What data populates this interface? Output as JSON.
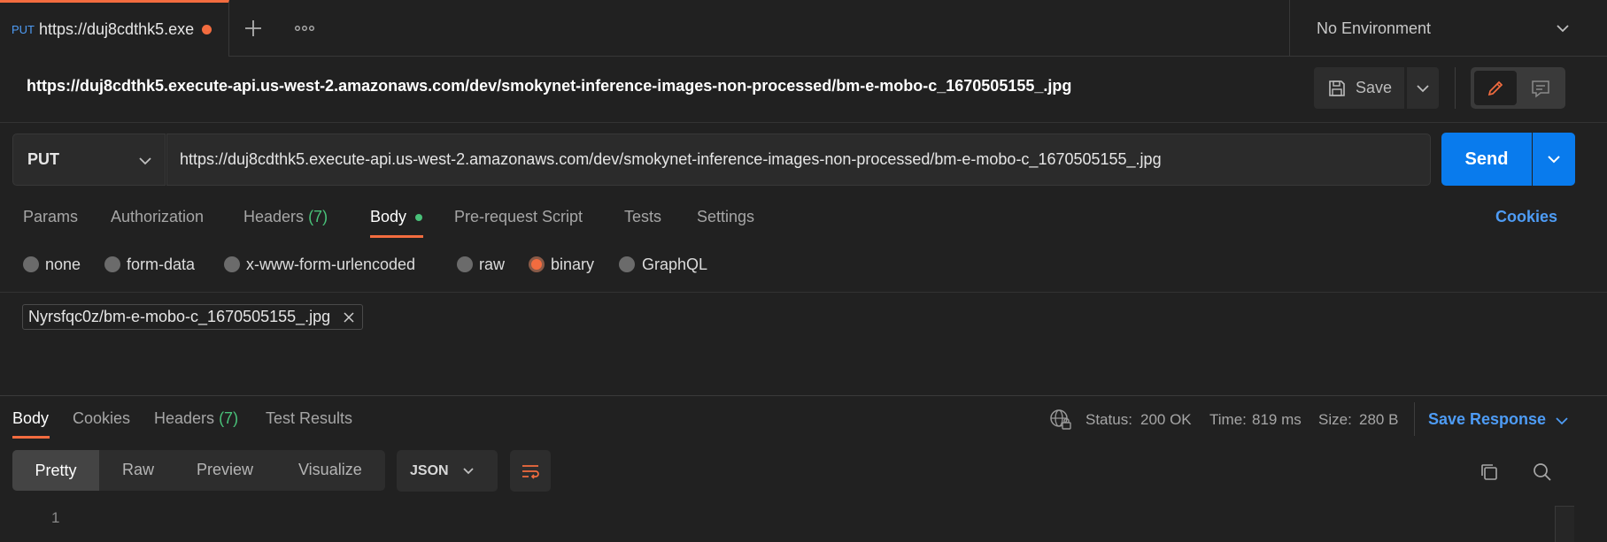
{
  "tab": {
    "method": "PUT",
    "name": "https://duj8cdthk5.exe"
  },
  "environment": {
    "selected": "No Environment"
  },
  "request": {
    "title": "https://duj8cdthk5.execute-api.us-west-2.amazonaws.com/dev/smokynet-inference-images-non-processed/bm-e-mobo-c_1670505155_.jpg",
    "save_label": "Save",
    "method": "PUT",
    "url": "https://duj8cdthk5.execute-api.us-west-2.amazonaws.com/dev/smokynet-inference-images-non-processed/bm-e-mobo-c_1670505155_.jpg",
    "send_label": "Send",
    "tabs": {
      "params": "Params",
      "authorization": "Authorization",
      "headers": "Headers",
      "headers_count": "(7)",
      "body": "Body",
      "prerequest": "Pre-request Script",
      "tests": "Tests",
      "settings": "Settings"
    },
    "cookies_label": "Cookies",
    "body_types": {
      "none": "none",
      "form_data": "form-data",
      "urlencoded": "x-www-form-urlencoded",
      "raw": "raw",
      "binary": "binary",
      "graphql": "GraphQL",
      "selected": "binary"
    },
    "file": "Nyrsfqc0z/bm-e-mobo-c_1670505155_.jpg"
  },
  "response": {
    "tabs": {
      "body": "Body",
      "cookies": "Cookies",
      "headers": "Headers",
      "headers_count": "(7)",
      "test_results": "Test Results"
    },
    "status_label": "Status:",
    "status_value": "200 OK",
    "time_label": "Time:",
    "time_value": "819 ms",
    "size_label": "Size:",
    "size_value": "280 B",
    "save_response": "Save Response",
    "views": {
      "pretty": "Pretty",
      "raw": "Raw",
      "preview": "Preview",
      "visualize": "Visualize"
    },
    "format": "JSON",
    "line_number": "1"
  },
  "colors": {
    "accent": "#f36c3f",
    "primary": "#097bed",
    "success": "#49c179",
    "link": "#4e9cf5",
    "background": "#212121"
  },
  "icons": [
    "plus-icon",
    "more-icon",
    "chevron-down-icon",
    "save-icon",
    "pencil-icon",
    "comment-icon",
    "globe-lock-icon",
    "wrap-icon",
    "copy-icon",
    "search-icon",
    "close-icon"
  ]
}
